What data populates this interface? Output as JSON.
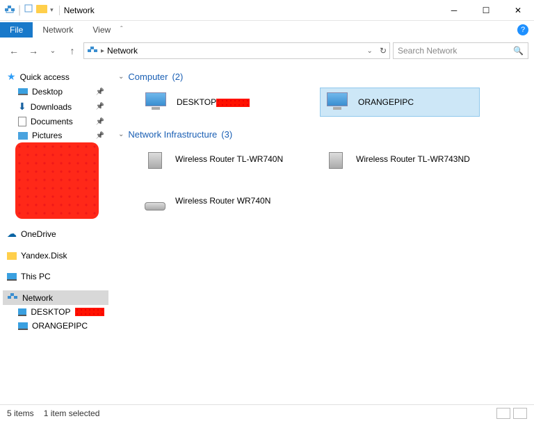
{
  "window": {
    "title": "Network"
  },
  "menubar": {
    "file": "File",
    "items": [
      "Network",
      "View"
    ]
  },
  "address": {
    "crumb": "Network",
    "refresh_icon": "↻",
    "dropdown_icon": "⌄"
  },
  "search": {
    "placeholder": "Search Network"
  },
  "sidebar": {
    "quick_access": "Quick access",
    "items": [
      {
        "label": "Desktop"
      },
      {
        "label": "Downloads"
      },
      {
        "label": "Documents"
      },
      {
        "label": "Pictures"
      }
    ],
    "onedrive": "OneDrive",
    "yandex": "Yandex.Disk",
    "thispc": "This PC",
    "network": "Network",
    "net_children": [
      {
        "label": "DESKTOP"
      },
      {
        "label": "ORANGEPIPC"
      }
    ]
  },
  "content": {
    "groups": [
      {
        "name": "Computer",
        "count": "(2)",
        "items": [
          {
            "label": "DESKTOP",
            "redacted": true,
            "selected": false
          },
          {
            "label": "ORANGEPIPC",
            "redacted": false,
            "selected": true
          }
        ]
      },
      {
        "name": "Network Infrastructure",
        "count": "(3)",
        "items": [
          {
            "label": "Wireless Router TL-WR740N"
          },
          {
            "label": "Wireless Router TL-WR743ND"
          },
          {
            "label": "Wireless Router WR740N"
          }
        ]
      }
    ]
  },
  "statusbar": {
    "count": "5 items",
    "selected": "1 item selected"
  }
}
